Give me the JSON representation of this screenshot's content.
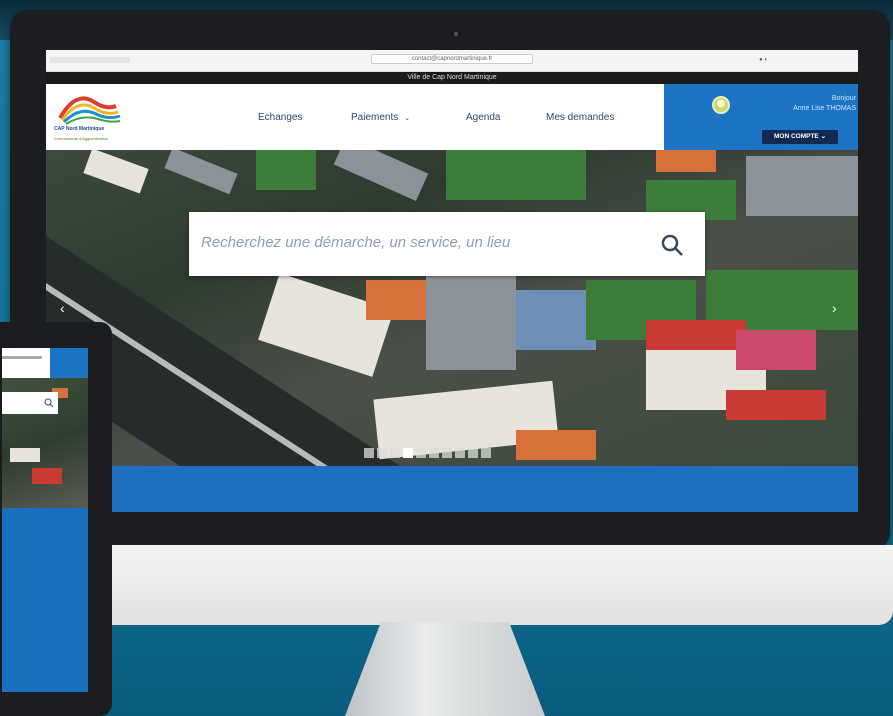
{
  "browser": {
    "url": "contact@capnordmartinique.fr",
    "city_banner": "Ville de Cap Nord Martinique"
  },
  "logo": {
    "name": "CAP Nord Martinique",
    "tagline": "Communauté d'Agglomération"
  },
  "nav": {
    "items": [
      {
        "label": "Echanges"
      },
      {
        "label": "Paiements"
      },
      {
        "label": "Agenda"
      },
      {
        "label": "Mes demandes"
      }
    ]
  },
  "user": {
    "greeting": "Bonjour",
    "name": "Anne Lise THOMAS",
    "account_button": "MON COMPTE"
  },
  "search": {
    "placeholder": "Recherchez une démarche, un service, un lieu"
  },
  "carousel": {
    "slide_count": 10,
    "active_index": 3
  },
  "colors": {
    "brand_blue": "#1e74c4",
    "dark_navy": "#0f2b52",
    "nav_text": "#2c4a73"
  }
}
